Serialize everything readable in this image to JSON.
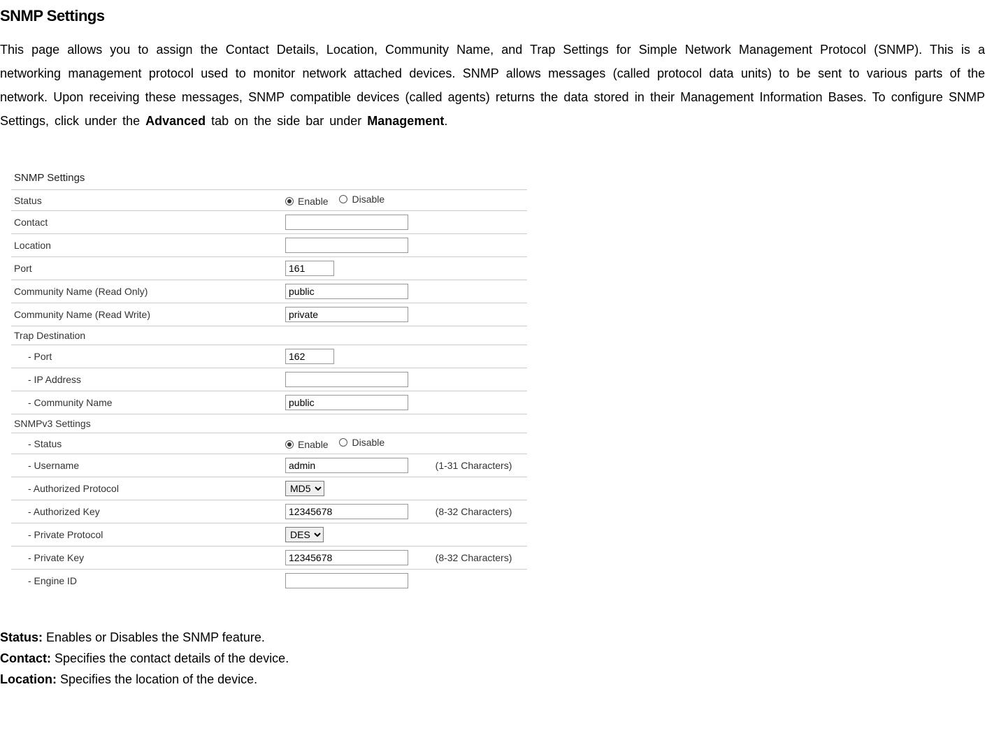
{
  "page_title": "SNMP Settings",
  "intro": {
    "text_part1": "This page allows you to assign the Contact Details, Location, Community Name, and Trap Settings for Simple Network Management Protocol (SNMP). This is a networking management protocol used to monitor network attached devices. SNMP allows messages (called protocol data units) to be sent to various parts of the network. Upon receiving these messages, SNMP compatible devices (called agents) returns the data stored in their Management Information Bases. To configure SNMP Settings, click under the ",
    "bold1": "Advanced",
    "text_part2": " tab on the side bar under ",
    "bold2": "Management",
    "text_part3": "."
  },
  "panel": {
    "title": "SNMP Settings",
    "rows": {
      "status_label": "Status",
      "status_enable": "Enable",
      "status_disable": "Disable",
      "contact_label": "Contact",
      "contact_value": "",
      "location_label": "Location",
      "location_value": "",
      "port_label": "Port",
      "port_value": "161",
      "comm_ro_label": "Community Name (Read Only)",
      "comm_ro_value": "public",
      "comm_rw_label": "Community Name (Read Write)",
      "comm_rw_value": "private",
      "trap_header": "Trap Destination",
      "trap_port_label": "- Port",
      "trap_port_value": "162",
      "trap_ip_label": "- IP Address",
      "trap_ip_value": "",
      "trap_comm_label": "- Community Name",
      "trap_comm_value": "public",
      "v3_header": "SNMPv3 Settings",
      "v3_status_label": "- Status",
      "v3_status_enable": "Enable",
      "v3_status_disable": "Disable",
      "v3_user_label": "- Username",
      "v3_user_value": "admin",
      "v3_user_hint": "(1-31 Characters)",
      "v3_authproto_label": "- Authorized Protocol",
      "v3_authproto_value": "MD5",
      "v3_authkey_label": "- Authorized Key",
      "v3_authkey_value": "12345678",
      "v3_authkey_hint": "(8-32 Characters)",
      "v3_privproto_label": "- Private Protocol",
      "v3_privproto_value": "DES",
      "v3_privkey_label": "- Private Key",
      "v3_privkey_value": "12345678",
      "v3_privkey_hint": "(8-32 Characters)",
      "v3_engine_label": "- Engine ID",
      "v3_engine_value": ""
    }
  },
  "definitions": [
    {
      "term": "Status:",
      "desc": " Enables or Disables the SNMP feature."
    },
    {
      "term": "Contact:",
      "desc": " Specifies the contact details of the device."
    },
    {
      "term": "Location:",
      "desc": " Specifies the location of the device."
    }
  ]
}
